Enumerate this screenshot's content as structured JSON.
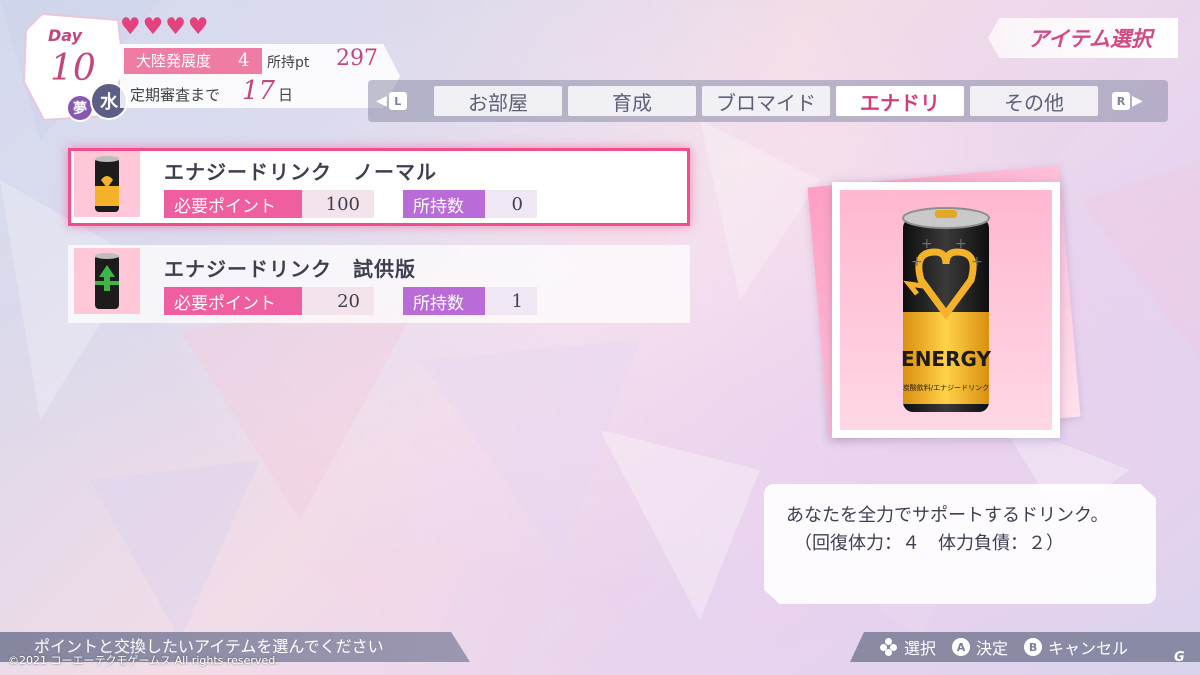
{
  "status": {
    "day_label": "Day",
    "day_number": "10",
    "dream_badge": "夢",
    "weekday": "水",
    "hearts": 4,
    "development_label": "大陸発展度",
    "development_value": "4",
    "points_label": "所持pt",
    "points_value": "297",
    "review_label": "定期審査まで",
    "review_days": "17",
    "review_unit": "日"
  },
  "screen_title": "アイテム選択",
  "tabs": {
    "left_key": "L",
    "right_key": "R",
    "items": [
      {
        "label": "お部屋"
      },
      {
        "label": "育成"
      },
      {
        "label": "ブロマイド"
      },
      {
        "label": "エナドリ"
      },
      {
        "label": "その他"
      }
    ],
    "active_index": 3
  },
  "items": [
    {
      "name": "エナジードリンク　ノーマル",
      "need_label": "必要ポイント",
      "need_value": "100",
      "owned_label": "所持数",
      "owned_value": "0",
      "selected": true,
      "can_color": "#1c1c1c",
      "accent_color": "#f4b22a"
    },
    {
      "name": "エナジードリンク　試供版",
      "need_label": "必要ポイント",
      "need_value": "20",
      "owned_label": "所持数",
      "owned_value": "1",
      "selected": false,
      "can_color": "#1c1c1c",
      "accent_color": "#3db54a"
    }
  ],
  "preview": {
    "can_label": "ENERGY",
    "can_sublabel": "炭酸飲料/エナジードリンク"
  },
  "description": {
    "line1": "あなたを全力でサポートするドリンク。",
    "line2": "（回復体力：４　体力負債：２）"
  },
  "footer": {
    "hint": "ポイントと交換したいアイテムを選んでください",
    "copyright": "©2021 コーエーテクモゲームス All rights reserved.",
    "controls": [
      {
        "icon": "dpad-icon",
        "label": "選択"
      },
      {
        "icon": "a-button-icon",
        "glyph": "A",
        "label": "決定"
      },
      {
        "icon": "b-button-icon",
        "glyph": "B",
        "label": "キャンセル"
      }
    ],
    "watermark": "G"
  },
  "colors": {
    "accent_pink": "#d03d7e",
    "need_pink": "#ef5fa0",
    "owned_purple": "#b96bd8",
    "heart": "#e5417f"
  }
}
